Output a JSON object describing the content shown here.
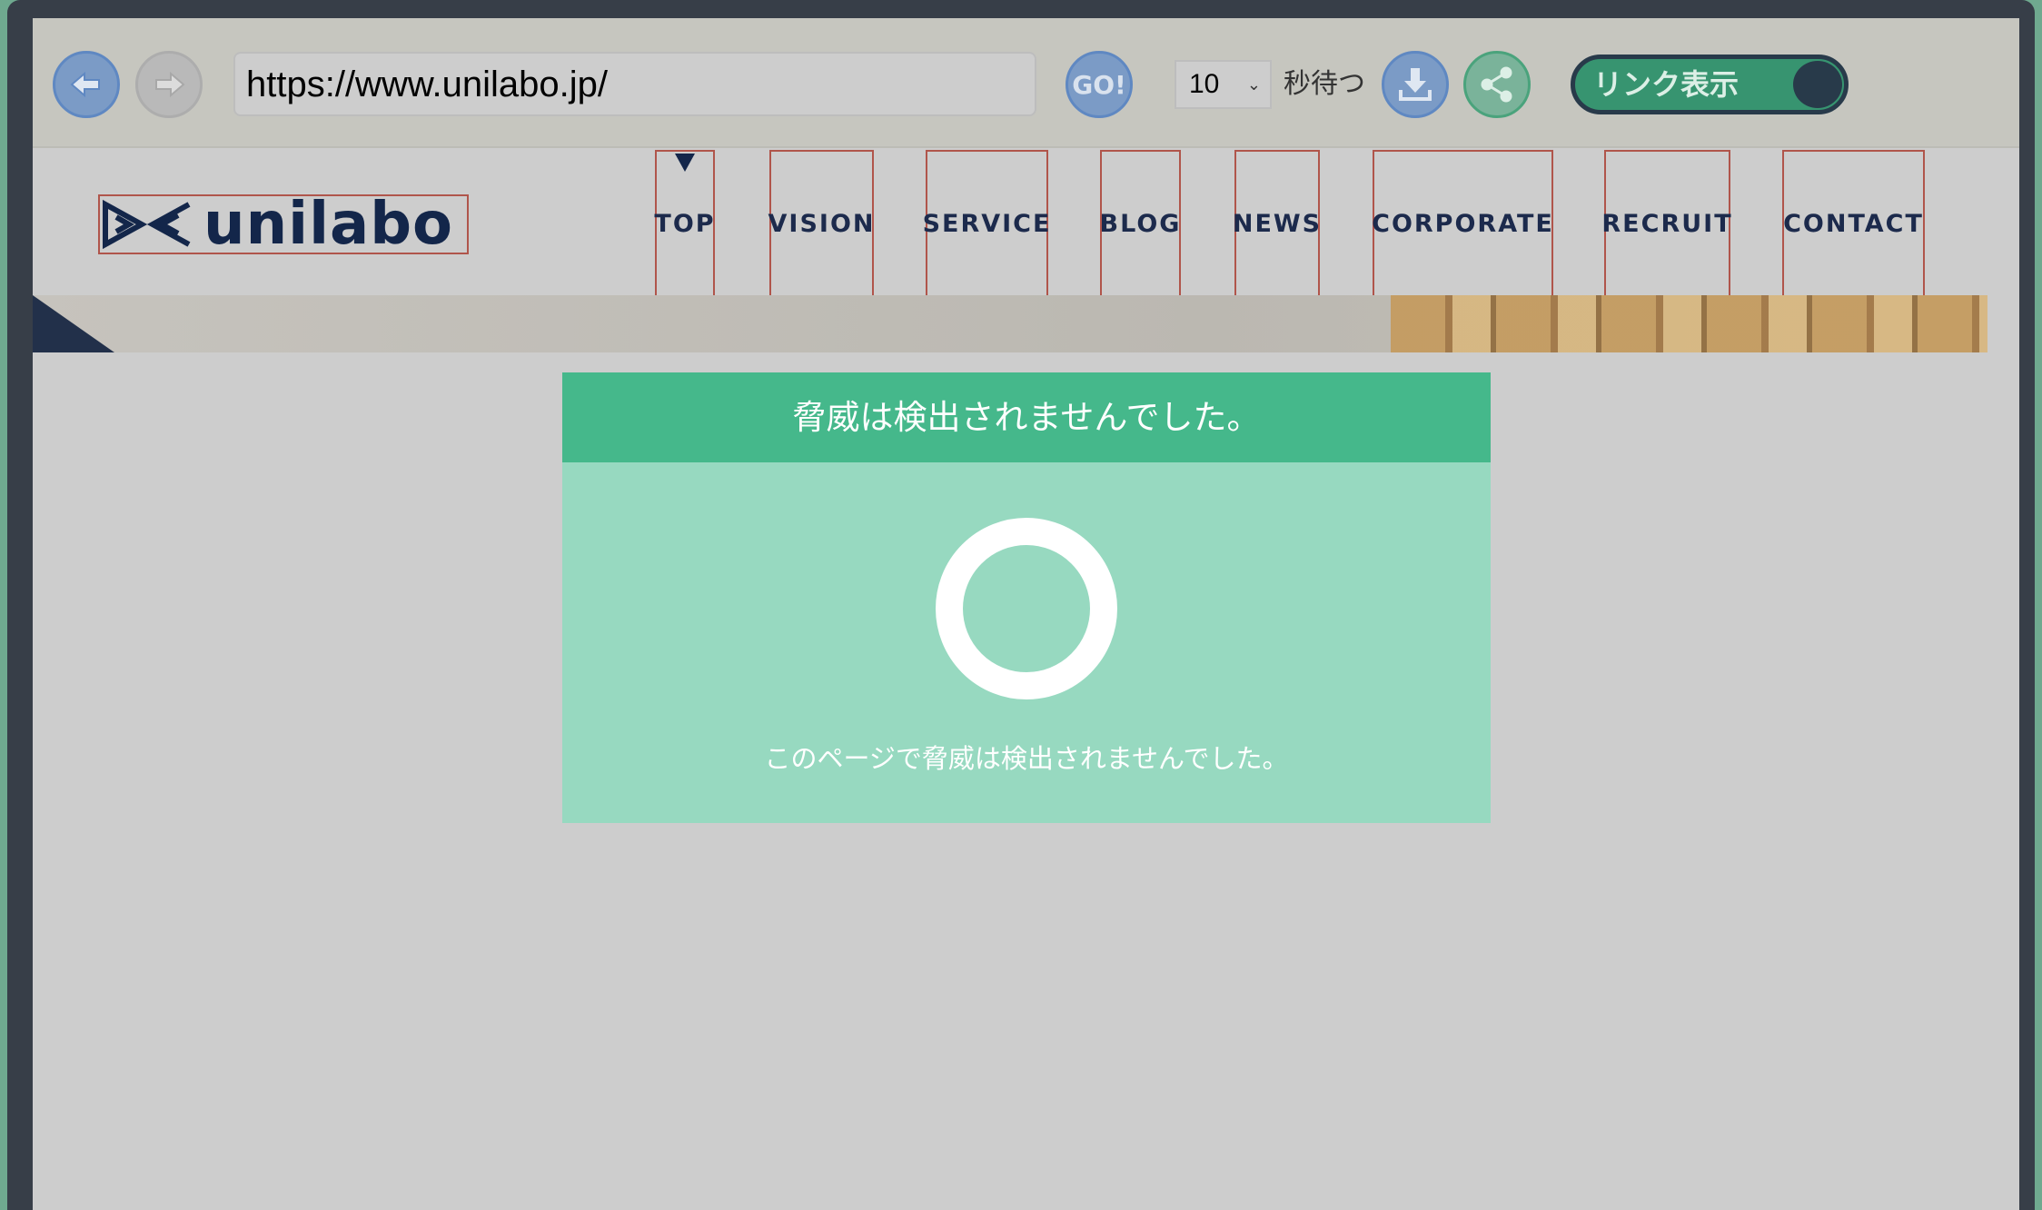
{
  "toolbar": {
    "back_icon": "arrow-left-icon",
    "forward_icon": "arrow-right-icon",
    "url": "https://www.unilabo.jp/",
    "go_label": "GO!",
    "wait_seconds": "10",
    "wait_label": "秒待つ",
    "download_icon": "download-icon",
    "share_icon": "share-icon",
    "link_toggle_label": "リンク表示",
    "link_toggle_on": true
  },
  "site": {
    "logo_text": "unilabo",
    "nav": [
      "TOP",
      "VISION",
      "SERVICE",
      "BLOG",
      "NEWS",
      "CORPORATE",
      "RECRUIT",
      "CONTACT"
    ]
  },
  "result": {
    "title": "脅威は検出されませんでした。",
    "message": "このページで脅威は検出されませんでした。",
    "header_color": "#45b88b",
    "body_color": "#97d9c0"
  }
}
